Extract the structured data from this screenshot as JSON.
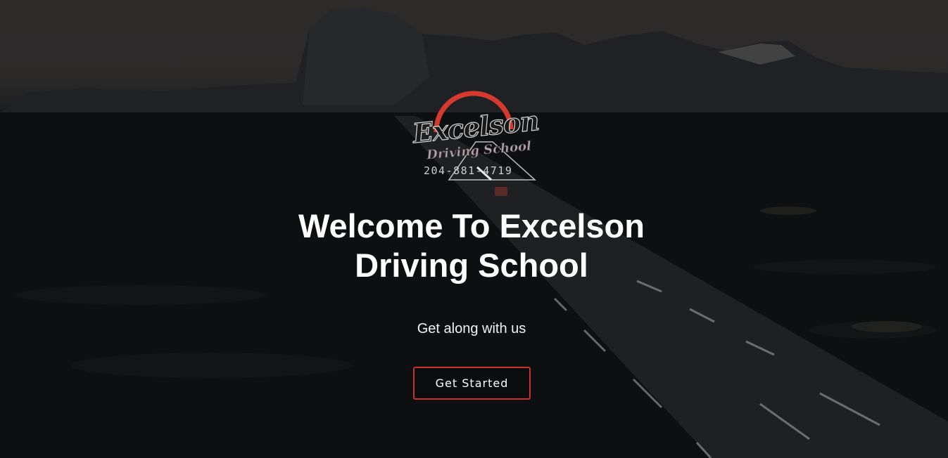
{
  "logo": {
    "wordmark": "Excelson",
    "subtitle": "Driving School",
    "phone": "204-881-4719",
    "accent_color": "#d63a2f"
  },
  "hero": {
    "title": "Welcome To Excelson Driving School",
    "tagline": "Get along with us",
    "cta_label": "Get Started",
    "cta_border_color": "#c8332b"
  }
}
